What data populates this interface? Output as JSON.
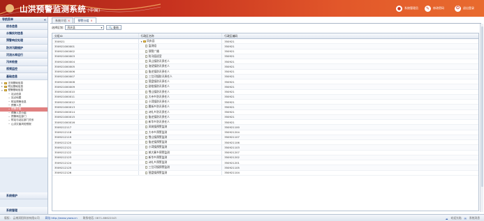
{
  "header": {
    "title": "山洪预警监测系统",
    "subtitle": "(中国)",
    "actions": [
      {
        "label": "系统管理员",
        "icon": "user-icon"
      },
      {
        "label": "修改密码",
        "icon": "key-icon"
      },
      {
        "label": "退出登录",
        "icon": "logout-icon"
      }
    ]
  },
  "sidebar": {
    "title": "导航菜单",
    "top_items": [
      "综合信息",
      "水情实时信息",
      "预警响应处理",
      "防洪汛期维护",
      "河流水库运行",
      "汛末检查",
      "视频监控",
      "基础信息"
    ],
    "tree": [
      {
        "label": "汪测基础信息",
        "level": 0,
        "type": "folder"
      },
      {
        "label": "附近基础信息",
        "level": 0,
        "type": "folder"
      },
      {
        "label": "预警基础信息",
        "level": 0,
        "type": "folder"
      },
      {
        "label": "站点信息",
        "level": 1,
        "type": "leaf"
      },
      {
        "label": "站点地图",
        "level": 1,
        "type": "leaf"
      },
      {
        "label": "附站预警信息",
        "level": 1,
        "type": "leaf"
      },
      {
        "label": "预警人员",
        "level": 1,
        "type": "leaf"
      },
      {
        "label": "预警分组",
        "level": 1,
        "type": "leaf",
        "selected": true
      },
      {
        "label": "预警人员分组",
        "level": 1,
        "type": "leaf"
      },
      {
        "label": "预警响应部门",
        "level": 1,
        "type": "leaf"
      },
      {
        "label": "附站与站区部门关系",
        "level": 1,
        "type": "leaf"
      },
      {
        "label": "山洪灾害风险预报",
        "level": 1,
        "type": "leaf"
      }
    ],
    "bottom_items": [
      "系统维护",
      "系统管理"
    ]
  },
  "tabs": [
    {
      "label": "系统介绍",
      "active": false
    },
    {
      "label": "预警分组",
      "active": true
    }
  ],
  "toolbar": {
    "select_label": "选择区划:",
    "select_value": "凤庆县",
    "search_button": "查询"
  },
  "grid": {
    "columns": [
      "分组ID",
      "行政区名称",
      "行政区编码"
    ],
    "rows": [
      {
        "id": "350921",
        "name": "凤庆县",
        "code": "350921",
        "type": "root"
      },
      {
        "id": "350921000001",
        "name": "监测组",
        "code": "350921",
        "type": "child"
      },
      {
        "id": "350921000002",
        "name": "预警广播",
        "code": "350921",
        "type": "child"
      },
      {
        "id": "350921000003",
        "name": "防汛值班室",
        "code": "350921",
        "type": "child"
      },
      {
        "id": "350921000004",
        "name": "凤山镇防汛责任人",
        "code": "350921",
        "type": "child"
      },
      {
        "id": "350921000005",
        "name": "洛党镇防汛责任人",
        "code": "350921",
        "type": "child"
      },
      {
        "id": "350921000006",
        "name": "鲁史镇防汛责任人",
        "code": "350921",
        "type": "child"
      },
      {
        "id": "350921000007",
        "name": "三岔河镇防汛责任人",
        "code": "350921",
        "type": "child"
      },
      {
        "id": "350921000008",
        "name": "营盘镇防汛责任人",
        "code": "350921",
        "type": "child"
      },
      {
        "id": "350921000009",
        "name": "勐佑镇防汛责任人",
        "code": "350921",
        "type": "child"
      },
      {
        "id": "350921000010",
        "name": "雪山镇防汛责任人",
        "code": "350921",
        "type": "child"
      },
      {
        "id": "350921000011",
        "name": "大寺乡防汛责任人",
        "code": "350921",
        "type": "child"
      },
      {
        "id": "350921000012",
        "name": "小湾镇防汛责任人",
        "code": "350921",
        "type": "child"
      },
      {
        "id": "350921000013",
        "name": "腰街乡防汛责任人",
        "code": "350921",
        "type": "child"
      },
      {
        "id": "350921000014",
        "name": "诗礼乡防汛责任人",
        "code": "350921",
        "type": "child"
      },
      {
        "id": "350921000015",
        "name": "鲁史镇防汛责任人",
        "code": "350921",
        "type": "child"
      },
      {
        "id": "350921000016",
        "name": "新华乡防汛责任人",
        "code": "350921",
        "type": "child"
      },
      {
        "id": "3509212117",
        "name": "凤筑镇预警监测",
        "code": "350921100",
        "type": "child"
      },
      {
        "id": "3509212118",
        "name": "大寺乡预警监测",
        "code": "350921204",
        "type": "child"
      },
      {
        "id": "3509212119",
        "name": "雪山镇预警监测",
        "code": "350921107",
        "type": "child"
      },
      {
        "id": "3509212120",
        "name": "鲁史镇预警监测",
        "code": "350921106",
        "type": "child"
      },
      {
        "id": "3509212121",
        "name": "小湾镇预警监测",
        "code": "350921103",
        "type": "child"
      },
      {
        "id": "3509212122",
        "name": "郭大寨乡预警监测",
        "code": "350921207",
        "type": "child"
      },
      {
        "id": "3509212123",
        "name": "新华乡预警监测",
        "code": "350921202",
        "type": "child"
      },
      {
        "id": "3509212124",
        "name": "诗礼乡预警监测",
        "code": "350921201",
        "type": "child"
      },
      {
        "id": "3509212125",
        "name": "三岔河镇预警监测",
        "code": "350921105",
        "type": "child"
      },
      {
        "id": "3509212126",
        "name": "营盘镇预警监测",
        "code": "350921104",
        "type": "child"
      }
    ]
  },
  "footer": {
    "company": "版权:　云南润阳科技有限公司",
    "url_label": "网址:http://www.yaow.cn",
    "phone": "联系电话: 0871-66622043",
    "right_items": [
      "欢迎光临",
      "系统消息"
    ]
  }
}
